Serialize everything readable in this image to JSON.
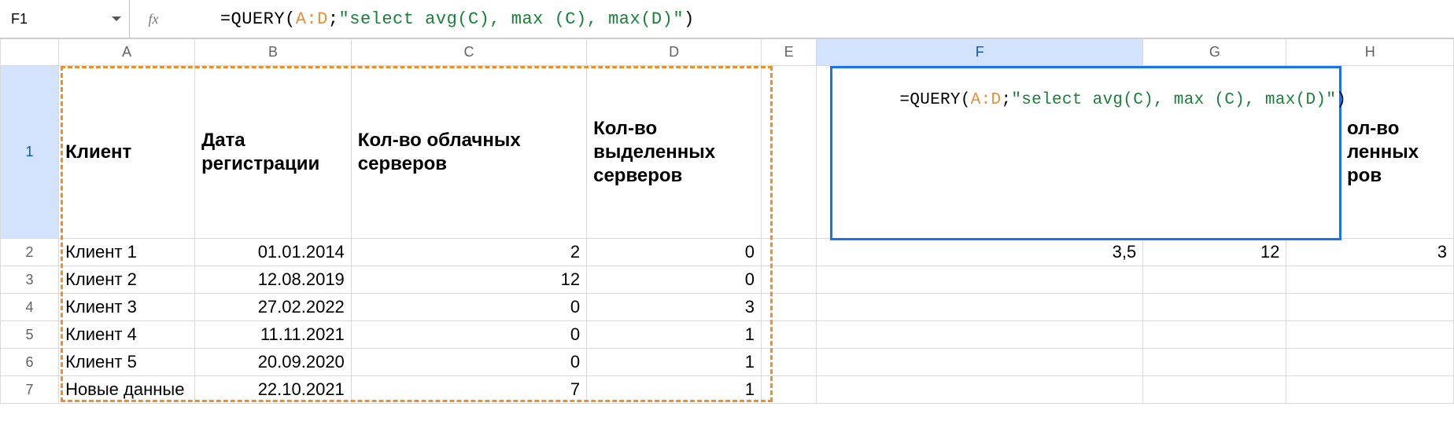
{
  "namebox": {
    "value": "F1"
  },
  "fx_label": "fx",
  "formula": {
    "eq": "=",
    "fn": "QUERY",
    "open": "(",
    "range": "A:D",
    "sep": ";",
    "str": "\"select avg(C), max (C), max(D)\"",
    "close": ")"
  },
  "col_headers": [
    "A",
    "B",
    "C",
    "D",
    "E",
    "F",
    "G",
    "H"
  ],
  "row_headers": [
    "1",
    "2",
    "3",
    "4",
    "5",
    "6",
    "7"
  ],
  "headers": {
    "A": "Клиент",
    "B": "Дата регистрации",
    "C": "Кол-во облачных серверов",
    "D": "Кол-во выделенных серверов"
  },
  "rows": [
    {
      "A": "Клиент 1",
      "B": "01.01.2014",
      "C": "2",
      "D": "0"
    },
    {
      "A": "Клиент 2",
      "B": "12.08.2019",
      "C": "12",
      "D": "0"
    },
    {
      "A": "Клиент 3",
      "B": "27.02.2022",
      "C": "0",
      "D": "3"
    },
    {
      "A": "Клиент 4",
      "B": "11.11.2021",
      "C": "0",
      "D": "1"
    },
    {
      "A": "Клиент 5",
      "B": "20.09.2020",
      "C": "0",
      "D": "1"
    },
    {
      "A": "Новые данные",
      "B": "22.10.2021",
      "C": "7",
      "D": "1"
    }
  ],
  "results": {
    "F2": "3,5",
    "G2": "12",
    "H2": "3"
  },
  "bleed_text": "Кол-во выделенных серверов",
  "bleed_visible": "ол-во\nленных\nров"
}
